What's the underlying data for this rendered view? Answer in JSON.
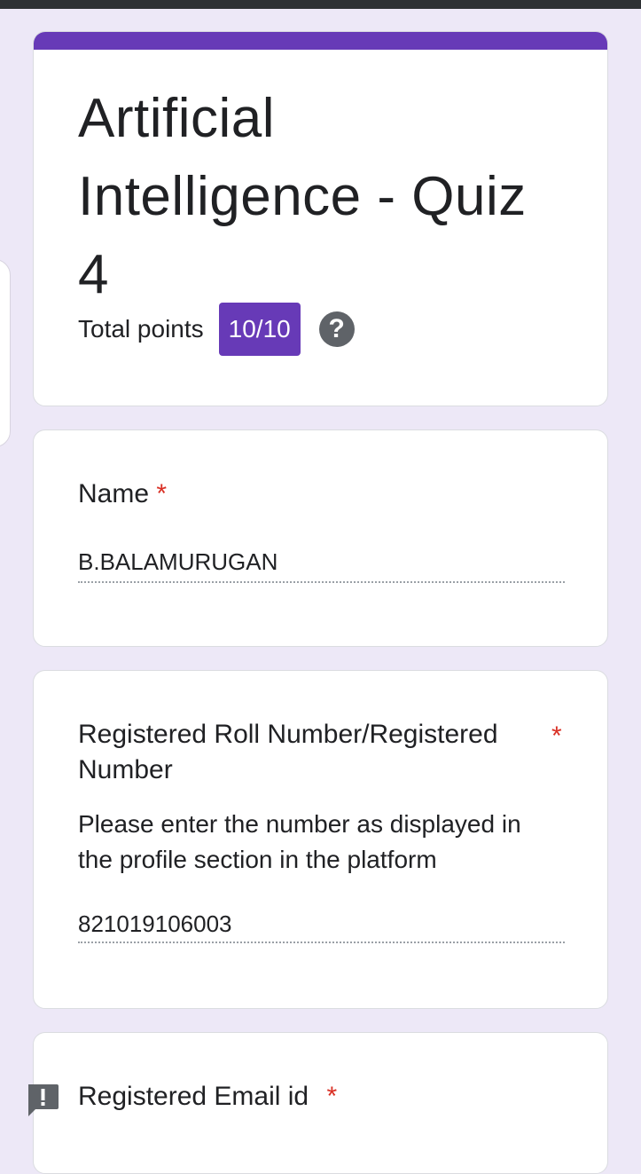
{
  "form": {
    "title": "Artificial Intelligence - Quiz 4",
    "total_points_label": "Total points",
    "score": "10/10",
    "help_glyph": "?"
  },
  "questions": [
    {
      "title": "Name",
      "required_mark": "*",
      "answer": "B.BALAMURUGAN"
    },
    {
      "title": "Registered Roll Number/Registered Number",
      "required_mark": "*",
      "helper": "Please enter the number as displayed in the profile section in the platform",
      "answer": "821019106003"
    },
    {
      "title": "Registered Email id",
      "required_mark": "*"
    }
  ],
  "icons": {
    "help": "help-circle-icon",
    "feedback": "report-feedback-icon"
  },
  "colors": {
    "accent": "#673ab7",
    "background": "#ede8f7",
    "required": "#d93025",
    "text": "#202124"
  }
}
